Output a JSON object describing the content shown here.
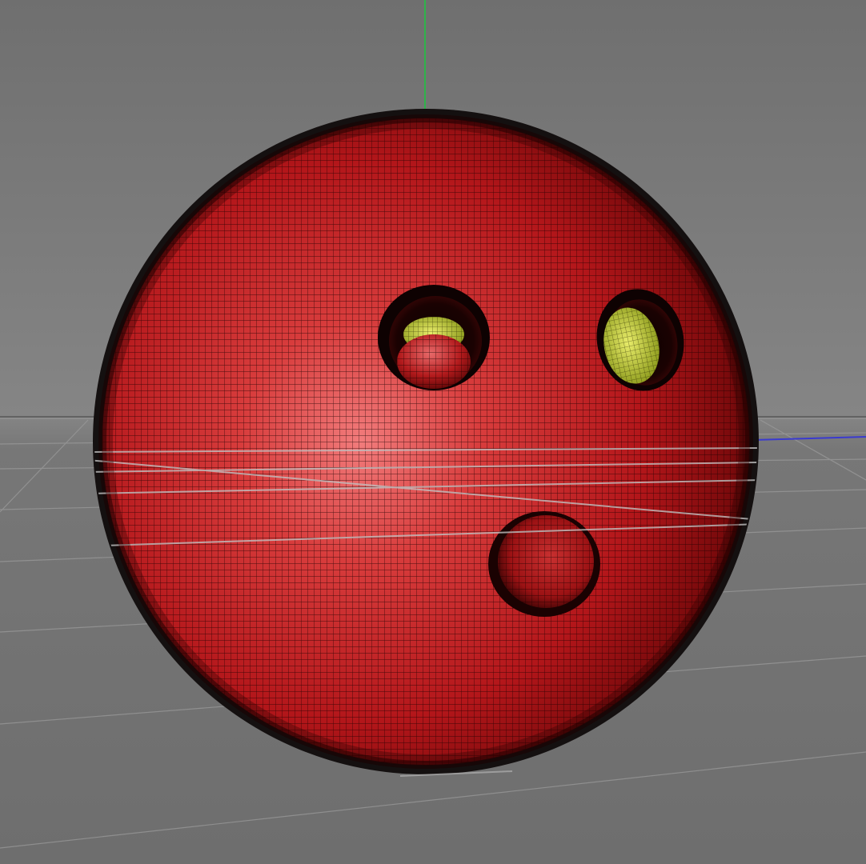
{
  "viewport": {
    "view": "perspective",
    "display_mode": "wireframe-on-shaded",
    "background_top_color": "#6f6f6f",
    "background_bottom_color": "#868686"
  },
  "axes": {
    "y_axis_color": "#2fb34a",
    "x_axis_color": "#3a3ad0",
    "grid_color": "#9a9a9a"
  },
  "scene": {
    "objects": [
      {
        "name": "bowling-ball",
        "type": "sphere-mesh",
        "base_color": "#b3161a",
        "highlight_color": "#f07070",
        "shadow_color": "#5a0608",
        "wire_color": "#1a0000",
        "finger_holes": 3,
        "insert_color": "#d6dc46"
      }
    ]
  }
}
